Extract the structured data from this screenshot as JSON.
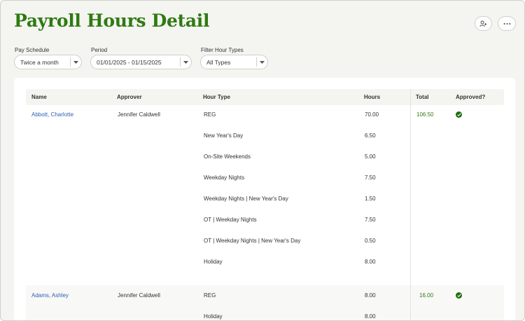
{
  "page": {
    "title": "Payroll Hours Detail"
  },
  "toolbar": {
    "user_icon": "person-add-icon",
    "more_icon": "more-icon"
  },
  "filters": {
    "pay_schedule": {
      "label": "Pay Schedule",
      "value": "Twice a month"
    },
    "period": {
      "label": "Period",
      "value": "01/01/2025 - 01/15/2025"
    },
    "hour_types": {
      "label": "Filter Hour Types",
      "value": "All Types"
    }
  },
  "table": {
    "columns": [
      "Name",
      "Approver",
      "Hour Type",
      "Hours",
      "Total",
      "Approved?"
    ],
    "employees": [
      {
        "name": "Abbott, Charlotte",
        "approver": "Jennifer Caldwell",
        "total": "106.50",
        "approved": true,
        "entries": [
          {
            "type": "REG",
            "hours": "70.00"
          },
          {
            "type": "New Year's Day",
            "hours": "6.50"
          },
          {
            "type": "On-Site Weekends",
            "hours": "5.00"
          },
          {
            "type": "Weekday Nights",
            "hours": "7.50"
          },
          {
            "type": "Weekday Nights | New Year's Day",
            "hours": "1.50"
          },
          {
            "type": "OT | Weekday Nights",
            "hours": "7.50"
          },
          {
            "type": "OT | Weekday Nights | New Year's Day",
            "hours": "0.50"
          },
          {
            "type": "Holiday",
            "hours": "8.00"
          }
        ]
      },
      {
        "name": "Adams, Ashley",
        "approver": "Jennifer Caldwell",
        "total": "16.00",
        "approved": true,
        "entries": [
          {
            "type": "REG",
            "hours": "8.00"
          },
          {
            "type": "Holiday",
            "hours": "8.00"
          }
        ]
      }
    ]
  },
  "colors": {
    "title": "#2f7a12",
    "link": "#2f5fb3",
    "approved": "#1f6d12"
  }
}
